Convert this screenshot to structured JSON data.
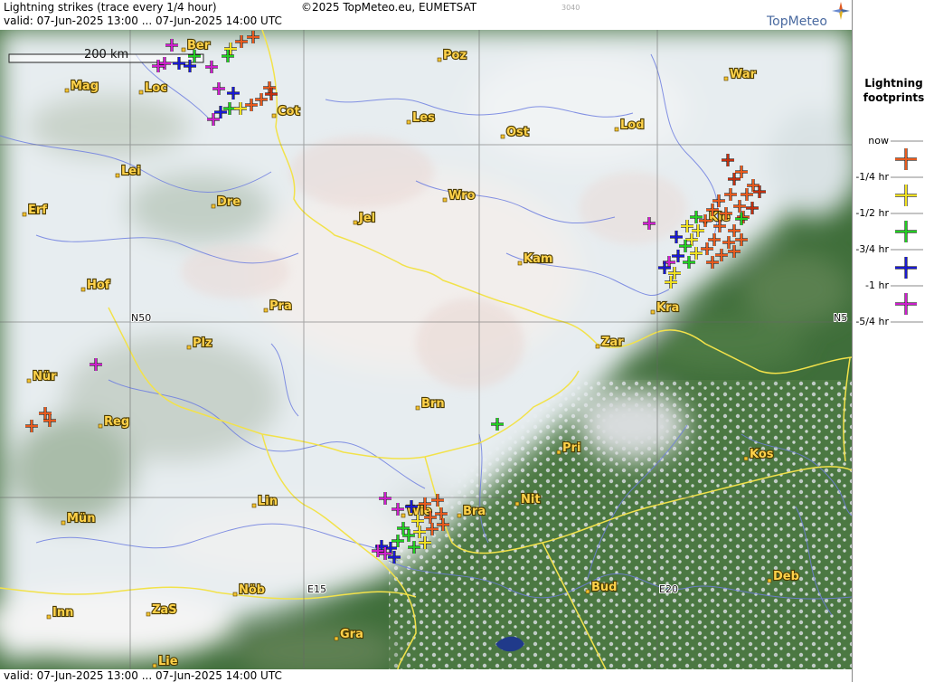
{
  "header": {
    "title": "Lightning strikes (trace every 1/4 hour)",
    "valid": "valid:  07-Jun-2025 13:00 ... 07-Jun-2025 14:00 UTC",
    "copyright": "©2025 TopMeteo.eu, EUMETSAT",
    "code": "3040",
    "logo": "TopMeteo"
  },
  "footer": {
    "valid": "valid:  07-Jun-2025 13:00 ... 07-Jun-2025 14:00 UTC"
  },
  "scale": {
    "label": "200 km"
  },
  "grid_labels": {
    "n50": "N50",
    "n50_right": "N5",
    "e15": "E15",
    "e20": "E20"
  },
  "cities": [
    {
      "name": "Ber"
    },
    {
      "name": "Poz"
    },
    {
      "name": "War"
    },
    {
      "name": "Mag"
    },
    {
      "name": "Loc"
    },
    {
      "name": "Cot"
    },
    {
      "name": "Les"
    },
    {
      "name": "Ost"
    },
    {
      "name": "Lod"
    },
    {
      "name": "Lei"
    },
    {
      "name": "Dre"
    },
    {
      "name": "Wro"
    },
    {
      "name": "Erf"
    },
    {
      "name": "Jel"
    },
    {
      "name": "Kie"
    },
    {
      "name": "Kam"
    },
    {
      "name": "Hof"
    },
    {
      "name": "Pra"
    },
    {
      "name": "Kra"
    },
    {
      "name": "Plz"
    },
    {
      "name": "Zar"
    },
    {
      "name": "Nür"
    },
    {
      "name": "Brn"
    },
    {
      "name": "Reg"
    },
    {
      "name": "Pri"
    },
    {
      "name": "Kos"
    },
    {
      "name": "Lin"
    },
    {
      "name": "Wie"
    },
    {
      "name": "Bra"
    },
    {
      "name": "Nit"
    },
    {
      "name": "Mün"
    },
    {
      "name": "Nöb"
    },
    {
      "name": "Bud"
    },
    {
      "name": "Deb"
    },
    {
      "name": "Inn"
    },
    {
      "name": "ZaS"
    },
    {
      "name": "Gra"
    },
    {
      "name": "Lie"
    }
  ],
  "legend": {
    "title_line1": "Lightning",
    "title_line2": "footprints",
    "items": [
      {
        "label": "now",
        "color": ""
      },
      {
        "label": "-1/4 hr",
        "color": "#e65a1e"
      },
      {
        "label": "-1/2 hr",
        "color": "#f0e020"
      },
      {
        "label": "-3/4 hr",
        "color": "#22cc22"
      },
      {
        "label": "-1 hr",
        "color": "#1a1ad0"
      },
      {
        "label": "-5/4 hr",
        "color": "#cc20cc"
      }
    ]
  },
  "colors": {
    "age_1": "#c03010",
    "age_2": "#e65a1e",
    "age_3": "#f0e020",
    "age_4": "#22cc22",
    "age_5": "#1a1ad0",
    "age_6": "#cc20cc",
    "border": "#f2e24a",
    "river": "#6f7fe0",
    "land": "#3f6e3a"
  }
}
